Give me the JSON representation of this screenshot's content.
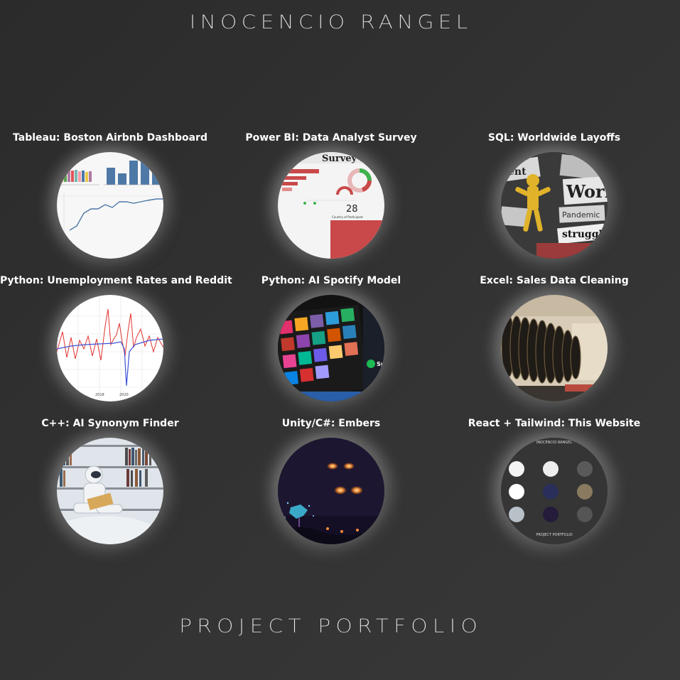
{
  "header": {
    "title": "Inocencio Rangel"
  },
  "projects": [
    {
      "label": "Tableau: Boston Airbnb Dashboard",
      "icon": "tableau-dashboard-thumbnail"
    },
    {
      "label": "Power BI: Data Analyst Survey",
      "icon": "powerbi-survey-thumbnail",
      "thumb_text": {
        "heading": "Survey Br",
        "number": "28",
        "caption": "Country of Participant"
      }
    },
    {
      "label": "SQL: Worldwide Layoffs",
      "icon": "layoffs-collage-thumbnail",
      "thumb_text": {
        "word1": "Work",
        "word2": "struggle",
        "word3": "Pandemic",
        "word4": "ent"
      }
    },
    {
      "label": "Python: Unemployment Rates and Reddit",
      "icon": "python-line-chart-thumbnail",
      "thumb_text": {
        "x1": "2018",
        "x2": "2020"
      }
    },
    {
      "label": "Python: AI Spotify Model",
      "icon": "spotify-screen-thumbnail",
      "thumb_text": {
        "brand": "Sp"
      }
    },
    {
      "label": "Excel: Sales Data Cleaning",
      "icon": "tire-rack-thumbnail"
    },
    {
      "label": "C++: AI Synonym Finder",
      "icon": "robot-reading-thumbnail"
    },
    {
      "label": "Unity/C#: Embers",
      "icon": "embers-game-thumbnail"
    },
    {
      "label": "React + Tailwind: This Website",
      "icon": "website-preview-thumbnail",
      "thumb_text": {
        "top": "INOCENCIO RANGEL",
        "bottom": "PROJECT PORTFOLIO"
      }
    }
  ],
  "footer": {
    "title": "Project Portfolio"
  },
  "colors": {
    "background": "#2f2f2f",
    "text": "#ffffff",
    "powerbi_red": "#c9494a",
    "tableau_blue": "#4e79a7",
    "spotify_green": "#1db954"
  }
}
